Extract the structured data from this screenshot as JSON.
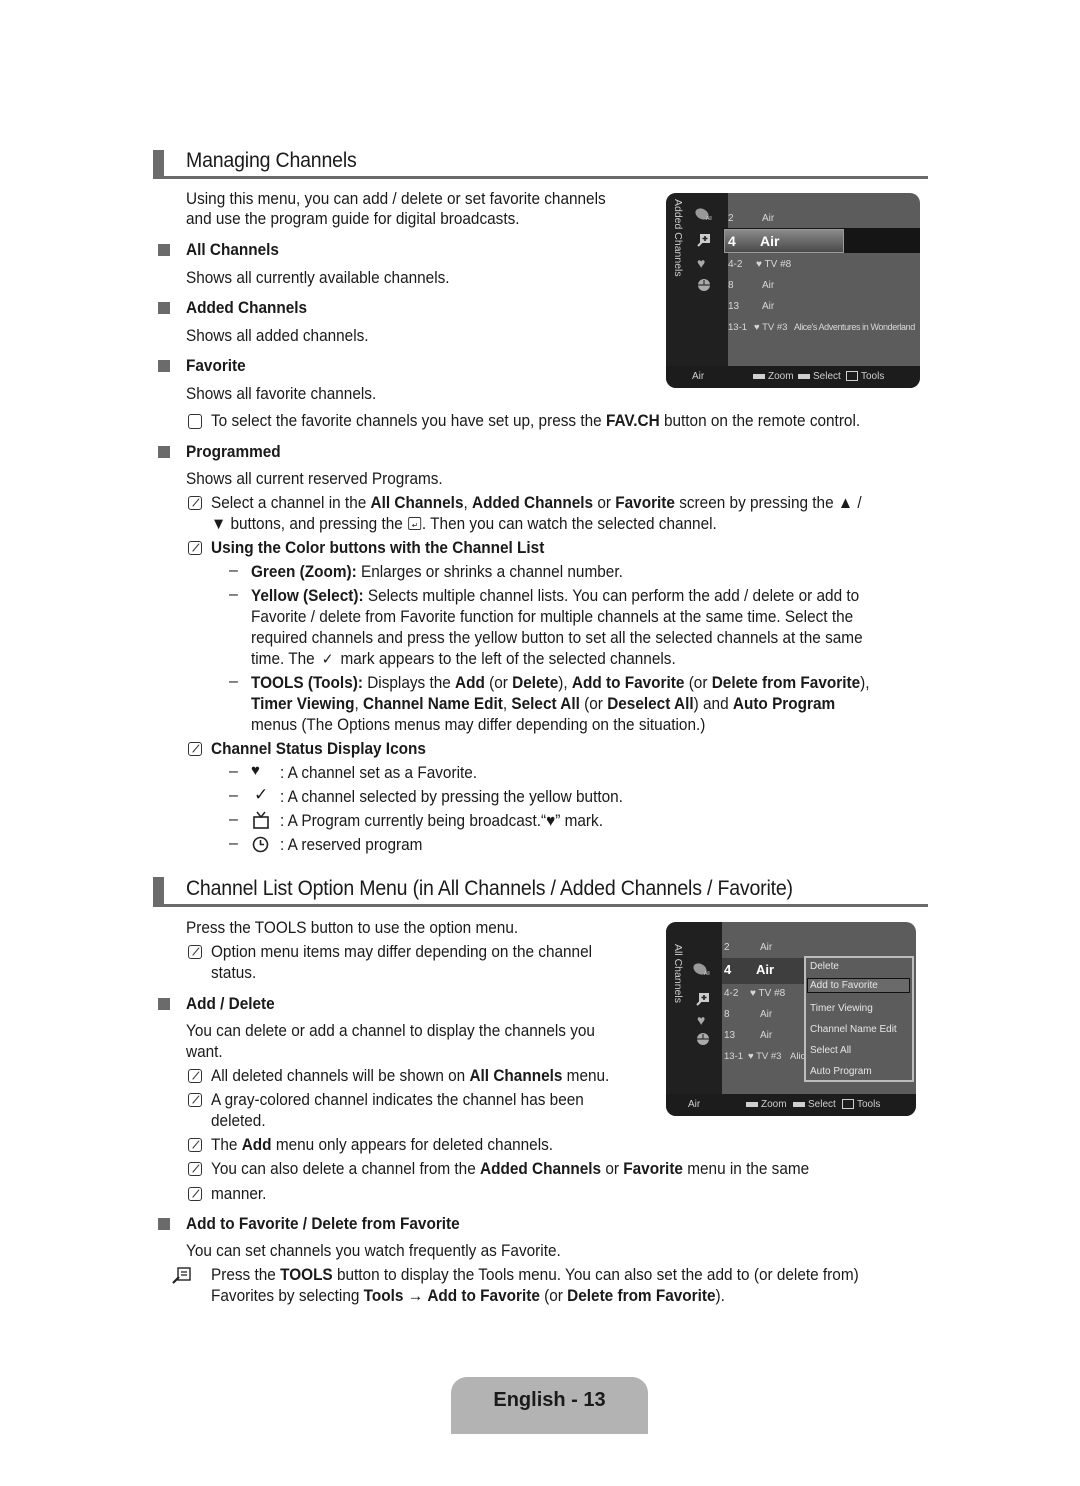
{
  "section1": {
    "title": "Managing Channels",
    "intro": [
      "Using this menu, you can add / delete or set favorite channels",
      "and use the program guide for digital broadcasts."
    ],
    "items": [
      {
        "heading": "All Channels",
        "desc": "Shows all currently available channels."
      },
      {
        "heading": "Added Channels",
        "desc": "Shows all added channels."
      },
      {
        "heading": "Favorite",
        "desc": "Shows all favorite channels."
      }
    ],
    "fav_note": {
      "pre": "To select the favorite channels you have set up, press the ",
      "bold": "FAV.CH",
      "post": " button on the remote control."
    },
    "programmed": {
      "heading": "Programmed",
      "desc": "Shows all current reserved Programs."
    },
    "select_note": {
      "l1_a": "Select a channel in the ",
      "l1_b": "All Channels",
      "l1_c": ", ",
      "l1_d": "Added Channels",
      "l1_e": " or ",
      "l1_f": "Favorite",
      "l1_g": " screen by pressing the ▲ /",
      "l2_a": "▼ buttons, and pressing the ",
      "l2_b": ". Then you can watch the selected channel."
    },
    "color_buttons": {
      "heading": "Using the Color buttons with the Channel List",
      "green_label": "Green (Zoom):",
      "green_text": " Enlarges or shrinks a channel number.",
      "yellow_label": "Yellow (Select):",
      "yellow_l1": " Selects multiple channel lists. You can perform the add / delete or add to",
      "yellow_l2": "Favorite / delete from Favorite function for multiple channels at the same time. Select the",
      "yellow_l3": "required channels and press the yellow button to set all the selected channels at the same",
      "yellow_l4a": "time. The ",
      "yellow_l4b": " mark appears to the left of the selected channels.",
      "tools_label": "TOOLS (Tools):",
      "tools_l1a": " Displays the ",
      "tools_add": "Add",
      "tools_l1b": " (or ",
      "tools_delete": "Delete",
      "tools_l1c": "), ",
      "tools_addfav": "Add to Favorite",
      "tools_l1d": " (or ",
      "tools_delfav": "Delete from Favorite",
      "tools_l1e": "),",
      "tools_timer": "Timer Viewing",
      "tools_comma1": ", ",
      "tools_cne": "Channel Name Edit",
      "tools_comma2": ", ",
      "tools_selall": "Select All",
      "tools_or": " (or ",
      "tools_desel": "Deselect All",
      "tools_and": ") and ",
      "tools_auto": "Auto Program",
      "tools_l3": "menus (The Options menus may differ depending on the situation.)"
    },
    "status_icons": {
      "heading": "Channel Status Display Icons",
      "items": [
        {
          "icon": "♥",
          "text": ": A channel set as a Favorite."
        },
        {
          "icon": "✓",
          "text": ": A channel selected by pressing the yellow button."
        },
        {
          "icon": "tv",
          "text": ": A Program currently being broadcast.“♥” mark."
        },
        {
          "icon": "clock",
          "text": ": A reserved program"
        }
      ]
    }
  },
  "tv1": {
    "side_label": "Added Channels",
    "rows": [
      {
        "num": "2",
        "name": "Air",
        "prog": ""
      },
      {
        "num": "4",
        "name": "Air",
        "prog": ""
      },
      {
        "num": "4-2",
        "name": "♥ TV #8",
        "prog": ""
      },
      {
        "num": "8",
        "name": "Air",
        "prog": ""
      },
      {
        "num": "13",
        "name": "Air",
        "prog": ""
      },
      {
        "num": "13-1",
        "name": "♥ TV #3",
        "prog": "Alice's Adventures in Wonderland"
      }
    ],
    "footer": {
      "source": "Air",
      "zoom": "Zoom",
      "select": "Select",
      "tools": "Tools"
    }
  },
  "section2": {
    "title": "Channel List Option Menu (in All Channels / Added Channels / Favorite)",
    "intro": "Press the TOOLS button to use the option menu.",
    "note1_l1": "Option menu items may differ depending on the channel",
    "note1_l2": "status.",
    "add_delete": {
      "heading": "Add / Delete",
      "desc_l1": "You can delete or add a channel to display the channels you",
      "desc_l2": "want.",
      "n1_a": "All deleted channels will be shown on ",
      "n1_b": "All Channels",
      "n1_c": " menu.",
      "n2_l1": "A gray-colored channel indicates the channel has been",
      "n2_l2": "deleted.",
      "n3_a": "The ",
      "n3_b": "Add",
      "n3_c": " menu only appears for deleted channels.",
      "n4_a": "You can also delete a channel from the ",
      "n4_b": "Added Channels",
      "n4_c": " or ",
      "n4_d": "Favorite",
      "n4_e": " menu in the same",
      "n5": "manner."
    },
    "favorite": {
      "heading": "Add to Favorite / Delete from Favorite",
      "desc": "You can set channels you watch frequently as Favorite.",
      "tools_a": "Press the ",
      "tools_b": "TOOLS",
      "tools_c": " button to display the Tools menu. You can also set the add to (or delete from)",
      "tools_d": "Favorites by selecting ",
      "tools_e": "Tools",
      "tools_f": " → ",
      "tools_g": "Add to Favorite",
      "tools_h": " (or ",
      "tools_i": "Delete from Favorite",
      "tools_j": ")."
    }
  },
  "tv2": {
    "side_label": "All Channels",
    "rows": [
      {
        "num": "2",
        "name": "Air"
      },
      {
        "num": "4",
        "name": "Air"
      },
      {
        "num": "4-2",
        "name": "♥ TV #8"
      },
      {
        "num": "8",
        "name": "Air"
      },
      {
        "num": "13",
        "name": "Air"
      },
      {
        "num": "13-1",
        "name": "♥ TV #3",
        "prog": "Alic"
      }
    ],
    "menu": [
      "Delete",
      "Add to Favorite",
      "Timer Viewing",
      "Channel Name Edit",
      "Select All",
      "Auto Program"
    ],
    "menu_selected": "Add to Favorite",
    "footer": {
      "source": "Air",
      "zoom": "Zoom",
      "select": "Select",
      "tools": "Tools"
    }
  },
  "page_label": "English - 13"
}
